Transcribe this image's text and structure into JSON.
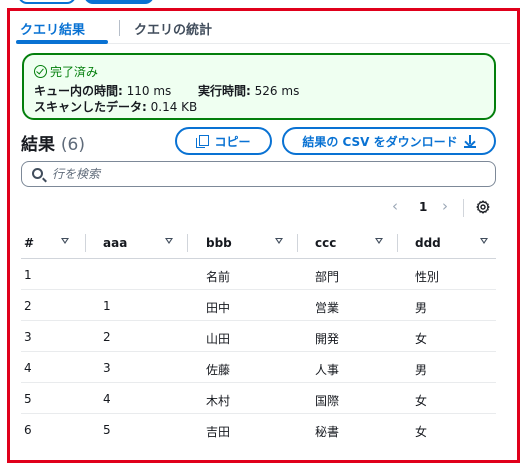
{
  "tabs": [
    {
      "label": "クエリ結果",
      "active": true
    },
    {
      "label": "クエリの統計",
      "active": false
    }
  ],
  "status": {
    "label": "完了済み",
    "queue_time_label": "キュー内の時間:",
    "queue_time_value": "110 ms",
    "exec_time_label": "実行時間:",
    "exec_time_value": "526 ms",
    "scanned_label": "スキャンしたデータ:",
    "scanned_value": "0.14 KB",
    "color": "#037f0c"
  },
  "results": {
    "title": "結果",
    "count": "(6)",
    "copy_label": "コピー",
    "download_label": "結果の CSV をダウンロード"
  },
  "search": {
    "placeholder": "行を検索"
  },
  "pagination": {
    "current_page": "1",
    "prev_icon": "chevron-left-icon",
    "next_icon": "chevron-right-icon",
    "settings_icon": "gear-icon"
  },
  "table": {
    "columns": [
      "#",
      "aaa",
      "bbb",
      "ccc",
      "ddd"
    ],
    "rows": [
      [
        "1",
        "",
        "名前",
        "部門",
        "性別"
      ],
      [
        "2",
        "1",
        "田中",
        "営業",
        "男"
      ],
      [
        "3",
        "2",
        "山田",
        "開発",
        "女"
      ],
      [
        "4",
        "3",
        "佐藤",
        "人事",
        "男"
      ],
      [
        "5",
        "4",
        "木村",
        "国際",
        "女"
      ],
      [
        "6",
        "5",
        "吉田",
        "秘書",
        "女"
      ]
    ]
  },
  "colors": {
    "accent": "#0972d3",
    "highlight_border": "#e0001b"
  }
}
